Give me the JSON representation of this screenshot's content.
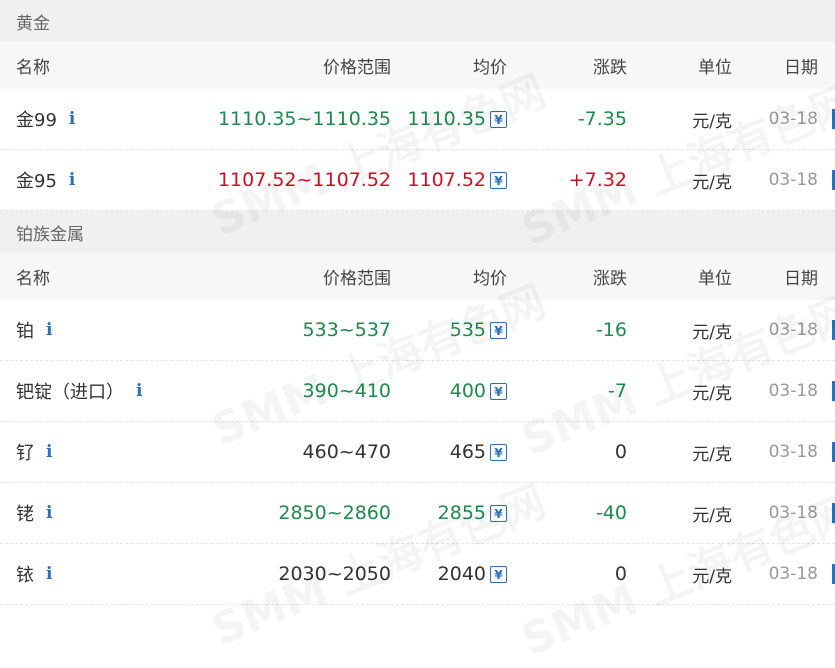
{
  "colors": {
    "up": "#cc1122",
    "down": "#1e8a4c",
    "flat": "#333333",
    "accent": "#2a6fb7"
  },
  "headers": {
    "name": "名称",
    "range": "价格范围",
    "avg": "均价",
    "change": "涨跌",
    "unit": "单位",
    "date": "日期"
  },
  "watermark": "SMM 上海有色网",
  "sections": [
    {
      "title": "黄金",
      "rows": [
        {
          "name": "金99",
          "range": "1110.35~1110.35",
          "avg": "1110.35",
          "change": "-7.35",
          "unit": "元/克",
          "date": "03-18",
          "trend": "down"
        },
        {
          "name": "金95",
          "range": "1107.52~1107.52",
          "avg": "1107.52",
          "change": "+7.32",
          "unit": "元/克",
          "date": "03-18",
          "trend": "up"
        }
      ]
    },
    {
      "title": "铂族金属",
      "rows": [
        {
          "name": "铂",
          "range": "533~537",
          "avg": "535",
          "change": "-16",
          "unit": "元/克",
          "date": "03-18",
          "trend": "down"
        },
        {
          "name": "钯锭（进口）",
          "range": "390~410",
          "avg": "400",
          "change": "-7",
          "unit": "元/克",
          "date": "03-18",
          "trend": "down"
        },
        {
          "name": "钌",
          "range": "460~470",
          "avg": "465",
          "change": "0",
          "unit": "元/克",
          "date": "03-18",
          "trend": "flat"
        },
        {
          "name": "铑",
          "range": "2850~2860",
          "avg": "2855",
          "change": "-40",
          "unit": "元/克",
          "date": "03-18",
          "trend": "down"
        },
        {
          "name": "铱",
          "range": "2030~2050",
          "avg": "2040",
          "change": "0",
          "unit": "元/克",
          "date": "03-18",
          "trend": "flat"
        }
      ]
    }
  ]
}
